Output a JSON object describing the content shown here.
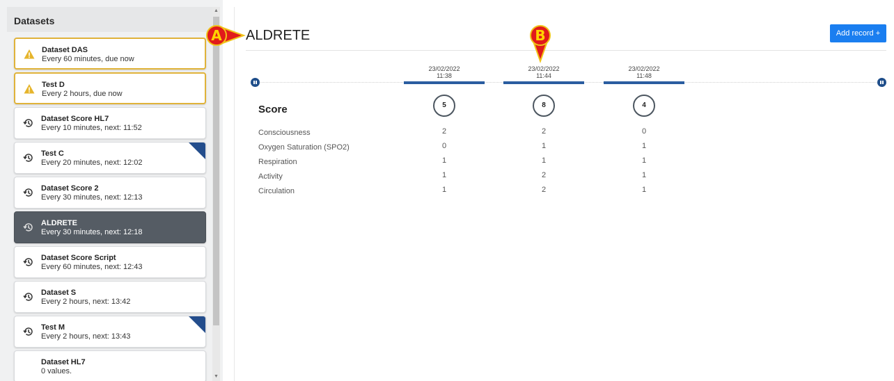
{
  "sidebar": {
    "title": "Datasets",
    "items": [
      {
        "name": "Dataset DAS",
        "sub": "Every 60 minutes, due now",
        "icon": "warning-icon"
      },
      {
        "name": "Test D",
        "sub": "Every 2 hours, due now",
        "icon": "warning-icon"
      },
      {
        "name": "Dataset Score HL7",
        "sub": "Every 10 minutes, next: 11:52",
        "icon": "history-icon"
      },
      {
        "name": "Test C",
        "sub": "Every 20 minutes, next: 12:02",
        "icon": "history-icon"
      },
      {
        "name": "Dataset Score 2",
        "sub": "Every 30 minutes, next: 12:13",
        "icon": "history-icon"
      },
      {
        "name": "ALDRETE",
        "sub": "Every 30 minutes, next: 12:18",
        "icon": "history-icon"
      },
      {
        "name": "Dataset Score Script",
        "sub": "Every 60 minutes, next: 12:43",
        "icon": "history-icon"
      },
      {
        "name": "Dataset S",
        "sub": "Every 2 hours, next: 13:42",
        "icon": "history-icon"
      },
      {
        "name": "Test M",
        "sub": "Every 2 hours, next: 13:43",
        "icon": "history-icon"
      },
      {
        "name": "Dataset HL7",
        "sub": "0 values.",
        "icon": ""
      }
    ]
  },
  "main": {
    "title": "ALDRETE",
    "add_record_label": "Add record +",
    "score_label": "Score",
    "rows": [
      "Consciousness",
      "Oxygen Saturation (SPO2)",
      "Respiration",
      "Activity",
      "Circulation"
    ],
    "columns": [
      {
        "date": "23/02/2022",
        "time": "11:38",
        "score": "5",
        "values": [
          "2",
          "0",
          "1",
          "1",
          "1"
        ]
      },
      {
        "date": "23/02/2022",
        "time": "11:44",
        "score": "8",
        "values": [
          "2",
          "1",
          "1",
          "2",
          "2"
        ]
      },
      {
        "date": "23/02/2022",
        "time": "11:48",
        "score": "4",
        "values": [
          "0",
          "1",
          "1",
          "1",
          "1"
        ]
      }
    ]
  },
  "callouts": {
    "a": "A",
    "b": "B"
  },
  "colors": {
    "accent": "#1a7ef0",
    "warning_border": "#e0b33a",
    "selected": "#555c64",
    "timeline": "#2a5da0",
    "callout": "#e11b1b"
  }
}
